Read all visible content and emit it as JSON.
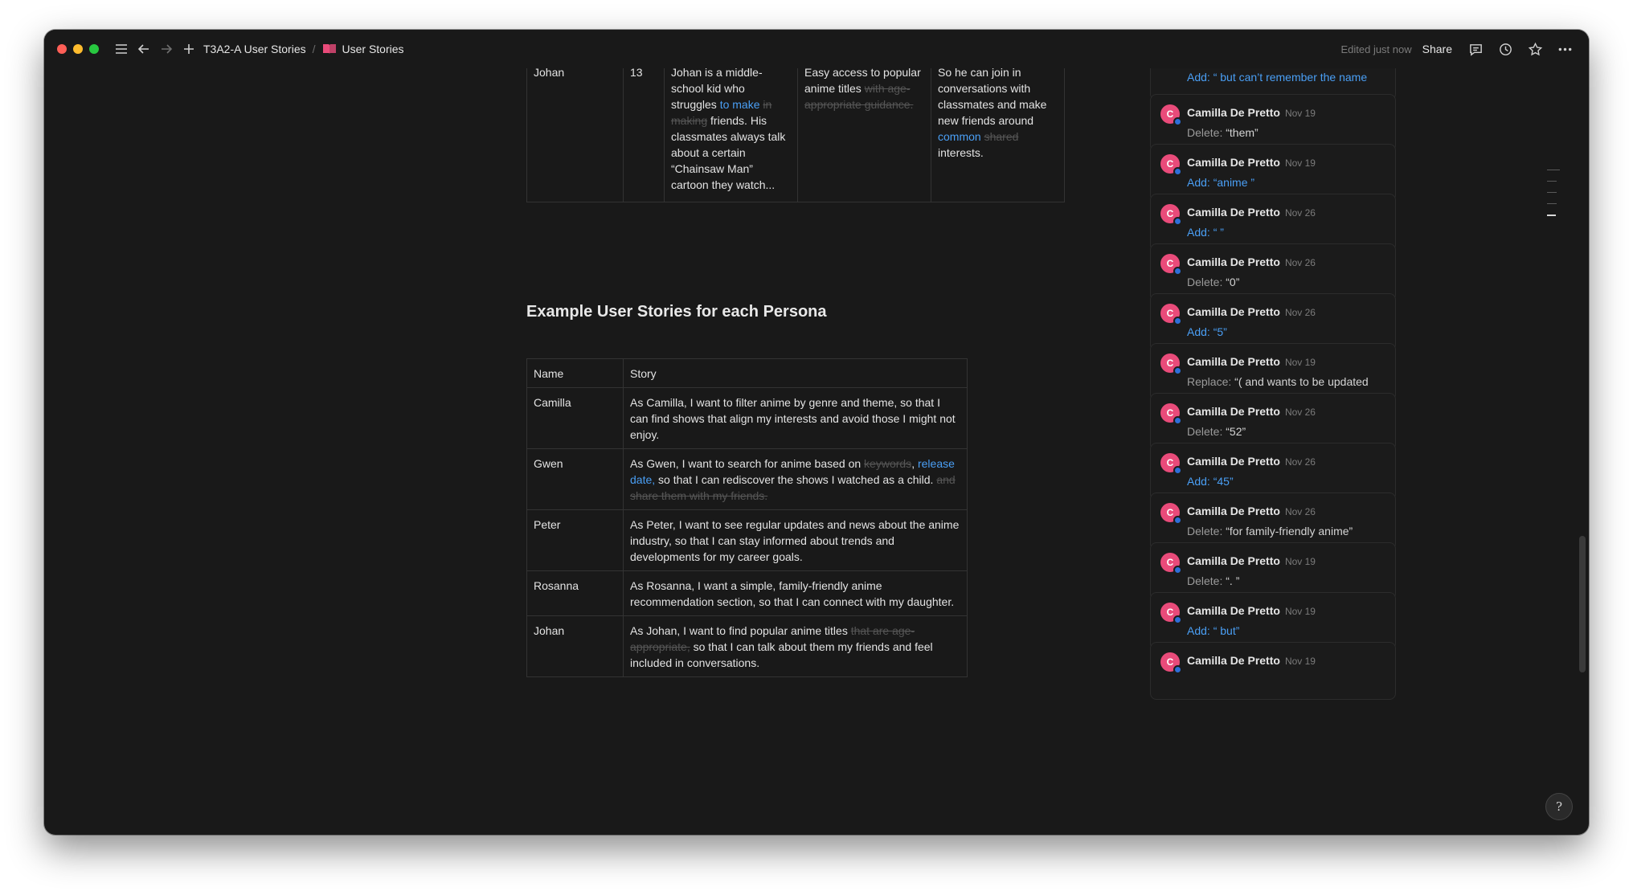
{
  "titlebar": {
    "breadcrumb": [
      "T3A2-A User Stories",
      "User Stories"
    ],
    "breadcrumb_separator": "/",
    "edited_status": "Edited just now",
    "share_label": "Share",
    "icons": [
      "menu-icon",
      "back-arrow-icon",
      "forward-arrow-icon",
      "plus-icon",
      "book-icon",
      "comment-icon",
      "history-icon",
      "star-icon",
      "more-icon"
    ],
    "book_icon_color": "#e94b7a"
  },
  "persona_table": {
    "row": {
      "name": "Johan",
      "age": "13",
      "background": [
        {
          "text": "Johan is a middle-school kid who struggles ",
          "style": "normal"
        },
        {
          "text": "to make",
          "style": "add"
        },
        {
          "text": " ",
          "style": "normal"
        },
        {
          "text": "in making",
          "style": "del"
        },
        {
          "text": " friends. His classmates always talk about a certain “Chainsaw Man” cartoon they watch...",
          "style": "normal"
        }
      ],
      "needs": [
        {
          "text": "Easy access to popular anime titles ",
          "style": "normal"
        },
        {
          "text": "with age-appropriate guidance.",
          "style": "del"
        }
      ],
      "goals": [
        {
          "text": "So he can join in conversations with classmates and make new friends around ",
          "style": "normal"
        },
        {
          "text": "common",
          "style": "add"
        },
        {
          "text": " ",
          "style": "normal"
        },
        {
          "text": "shared",
          "style": "del"
        },
        {
          "text": " interests.",
          "style": "normal"
        }
      ]
    }
  },
  "section_title": "Example User Stories for each Persona",
  "story_table": {
    "headers": [
      "Name",
      "Story"
    ],
    "rows": [
      {
        "name": "Camilla",
        "story": [
          {
            "text": "As Camilla, I want to filter anime by genre and theme, so that I can find shows that align my interests and avoid those I might not enjoy.",
            "style": "normal"
          }
        ]
      },
      {
        "name": "Gwen",
        "story": [
          {
            "text": "As Gwen, I want to search for anime based on ",
            "style": "normal"
          },
          {
            "text": "keywords",
            "style": "del"
          },
          {
            "text": ", ",
            "style": "normal"
          },
          {
            "text": "release date,",
            "style": "add"
          },
          {
            "text": "  so that I can rediscover the shows I watched as a child. ",
            "style": "normal"
          },
          {
            "text": "and share them with my friends.",
            "style": "del"
          }
        ]
      },
      {
        "name": "Peter",
        "story": [
          {
            "text": "As Peter, I want to see regular updates and news about the anime industry, so that I can stay informed about trends and developments for my career goals.",
            "style": "normal"
          }
        ]
      },
      {
        "name": "Rosanna",
        "story": [
          {
            "text": "As Rosanna, I want a simple, family-friendly anime recommendation section, so that I can connect with my daughter.",
            "style": "normal"
          }
        ]
      },
      {
        "name": "Johan",
        "story": [
          {
            "text": "As Johan, I want to find popular anime titles ",
            "style": "normal"
          },
          {
            "text": "that are age-appropriate,",
            "style": "del"
          },
          {
            "text": " so that I can talk about them my friends and feel included in conversations.",
            "style": "normal"
          }
        ]
      }
    ]
  },
  "comments": [
    {
      "author": "",
      "date": "",
      "action": "Add:",
      "value": "“ but can’t remember the name",
      "kind": "add",
      "partial": true
    },
    {
      "author": "Camilla De Pretto",
      "date": "Nov 19",
      "action": "Delete:",
      "value": "“them”",
      "kind": "delete"
    },
    {
      "author": "Camilla De Pretto",
      "date": "Nov 19",
      "action": "Add:",
      "value": "“anime ”",
      "kind": "add"
    },
    {
      "author": "Camilla De Pretto",
      "date": "Nov 26",
      "action": "Add:",
      "value": "“ ”",
      "kind": "add"
    },
    {
      "author": "Camilla De Pretto",
      "date": "Nov 26",
      "action": "Delete:",
      "value": "“0”",
      "kind": "delete"
    },
    {
      "author": "Camilla De Pretto",
      "date": "Nov 26",
      "action": "Add:",
      "value": "“5”",
      "kind": "add"
    },
    {
      "author": "Camilla De Pretto",
      "date": "Nov 19",
      "action": "Replace:",
      "value": "“( and wants to be updated",
      "kind": "replace"
    },
    {
      "author": "Camilla De Pretto",
      "date": "Nov 26",
      "action": "Delete:",
      "value": "“52”",
      "kind": "delete"
    },
    {
      "author": "Camilla De Pretto",
      "date": "Nov 26",
      "action": "Add:",
      "value": "“45”",
      "kind": "add"
    },
    {
      "author": "Camilla De Pretto",
      "date": "Nov 26",
      "action": "Delete:",
      "value": "“for family-friendly anime”",
      "kind": "delete"
    },
    {
      "author": "Camilla De Pretto",
      "date": "Nov 19",
      "action": "Delete:",
      "value": "“. ”",
      "kind": "delete"
    },
    {
      "author": "Camilla De Pretto",
      "date": "Nov 19",
      "action": "Add:",
      "value": "“ but”",
      "kind": "add"
    },
    {
      "author": "Camilla De Pretto",
      "date": "Nov 19",
      "action": "",
      "value": "",
      "kind": "add",
      "partial": true
    }
  ],
  "avatar_initial": "C",
  "colors": {
    "background": "#191919",
    "added_text": "#4a9ff5",
    "deleted_text": "#555555",
    "avatar": "#e94b7a"
  },
  "help_button_label": "?"
}
